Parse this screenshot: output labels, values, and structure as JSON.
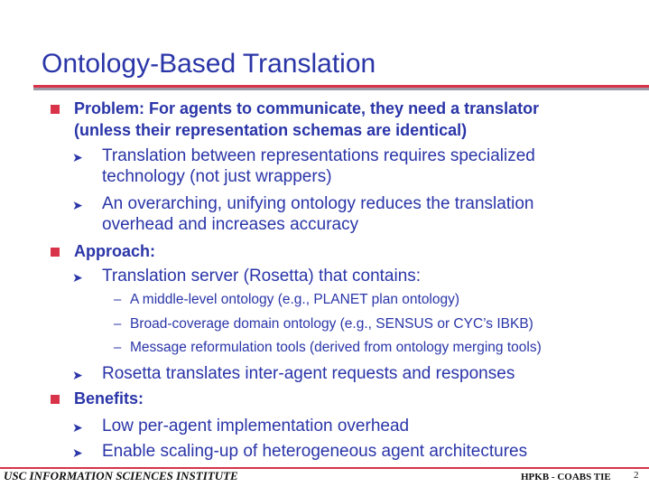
{
  "slide": {
    "title": "Ontology-Based Translation"
  },
  "bullets": {
    "problem": {
      "line1": "Problem: For agents to communicate, they need a translator",
      "line2": "(unless their representation schemas are identical)",
      "subs": [
        {
          "line1": "Translation between representations requires specialized",
          "line2": "technology (not just wrappers)"
        },
        {
          "line1": "An overarching, unifying ontology reduces the translation",
          "line2": "overhead and increases accuracy"
        }
      ]
    },
    "approach": {
      "label": "Approach:",
      "sub1": "Translation server (Rosetta) that contains:",
      "subsubs": [
        "A middle-level ontology (e.g., PLANET plan ontology)",
        "Broad-coverage domain ontology (e.g., SENSUS or CYC’s IBKB)",
        "Message reformulation tools (derived from ontology merging tools)"
      ],
      "sub2": "Rosetta translates inter-agent requests and responses"
    },
    "benefits": {
      "label": "Benefits:",
      "subs": [
        "Low per-agent implementation overhead",
        "Enable scaling-up of heterogeneous agent architectures"
      ]
    }
  },
  "icons": {
    "level1": "square-bullet-icon",
    "level2": "arrowhead-bullet-icon",
    "level3": "dash-bullet-icon"
  },
  "glyphs": {
    "arrow": "➤",
    "dash": "–"
  },
  "footer": {
    "left": "USC INFORMATION SCIENCES INSTITUTE",
    "right": "HPKB - COABS  TIE",
    "page_number": "2"
  },
  "colors": {
    "text_blue": "#2a35a8",
    "accent_red": "#d9334a",
    "rule_gray": "#9a9aa6"
  }
}
